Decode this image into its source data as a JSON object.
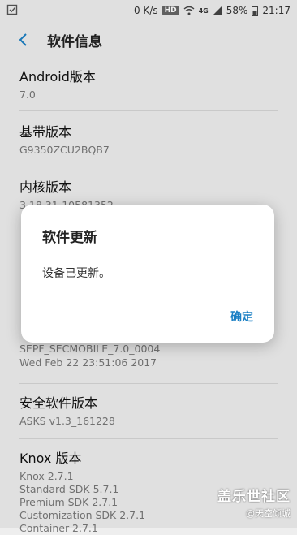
{
  "status_bar": {
    "speed": "0 K/s",
    "hd_badge": "HD",
    "network": "4G",
    "battery": "58%",
    "time": "21:17",
    "icons": [
      "checkbox-notification-icon",
      "wifi-icon",
      "signal-icon",
      "battery-icon"
    ]
  },
  "app_bar": {
    "title": "软件信息",
    "back_icon": "back-arrow-icon"
  },
  "items": [
    {
      "label": "Android版本",
      "values": [
        "7.0"
      ]
    },
    {
      "label": "基带版本",
      "values": [
        "G9350ZCU2BQB7"
      ]
    },
    {
      "label": "内核版本",
      "values": [
        "3.18.31-10581352"
      ]
    },
    {
      "label": "",
      "values": [
        "SEPF_SECMOBILE_7.0_0004",
        "Wed Feb 22 23:51:06 2017"
      ]
    },
    {
      "label": "安全软件版本",
      "values": [
        "ASKS v1.3_161228"
      ]
    },
    {
      "label": "Knox 版本",
      "values": [
        "Knox 2.7.1",
        "Standard SDK 5.7.1",
        "Premium SDK 2.7.1",
        "Customization SDK 2.7.1",
        "Container 2.7.1"
      ]
    }
  ],
  "dialog": {
    "title": "软件更新",
    "message": "设备已更新。",
    "ok_label": "确定"
  },
  "watermark": {
    "line1": "盖乐世社区",
    "line2": "@天空倾城"
  },
  "colors": {
    "accent": "#1a7fc4",
    "background": "#eeeeee"
  }
}
